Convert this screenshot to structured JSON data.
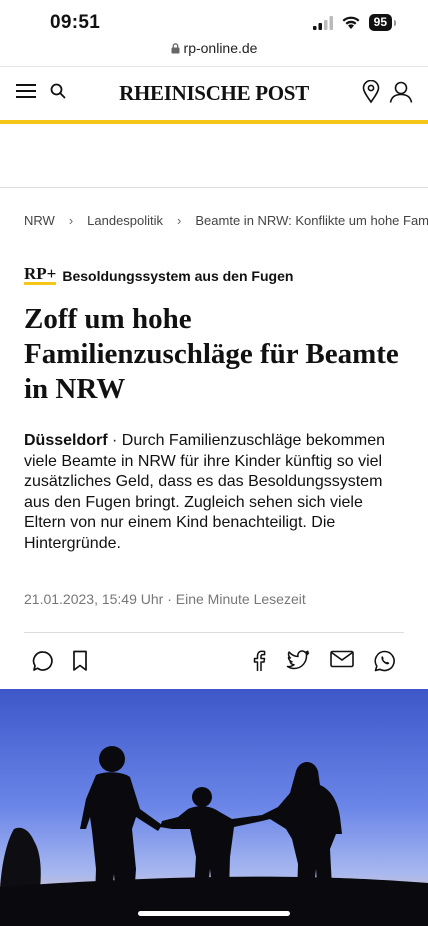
{
  "status": {
    "time": "09:51",
    "battery": "95"
  },
  "browser": {
    "url": "rp-online.de"
  },
  "header": {
    "logo": "RHEINISCHE POST"
  },
  "breadcrumb": [
    "NRW",
    "Landespolitik",
    "Beamte in NRW: Konflikte um hohe Famil"
  ],
  "article": {
    "kicker_brand": "RP+",
    "kicker": "Besoldungssystem aus den Fugen",
    "headline": "Zoff um hohe Familienzuschläge für Beamte in NRW",
    "dateline": "Düsseldorf",
    "lede": " · Durch Familienzuschläge bekommen viele Beamte in NRW für ihre Kinder künftig so viel zusätzliches Geld, dass es das Besoldungssystem aus den Fugen bringt. Zugleich sehen sich viele Eltern von nur einem Kind benachteiligt. Die Hintergründe.",
    "meta": "21.01.2023, 15:49 Uhr · Eine Minute Lesezeit"
  },
  "colors": {
    "accent": "#f5c518",
    "text": "#111111",
    "muted": "#777777"
  }
}
